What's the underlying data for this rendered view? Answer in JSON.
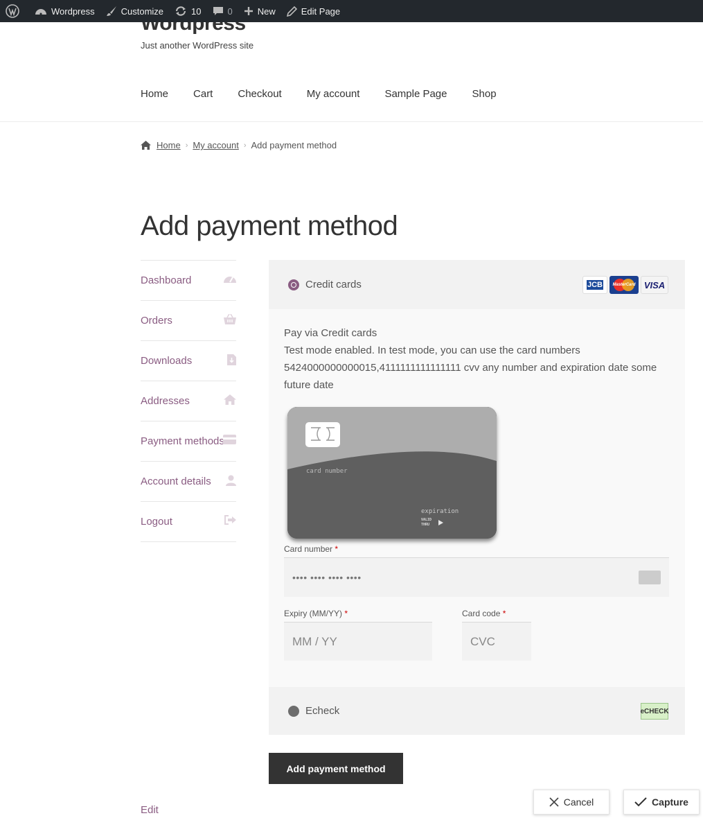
{
  "admin_bar": {
    "site": "Wordpress",
    "customize": "Customize",
    "updates": "10",
    "comments": "0",
    "new": "New",
    "edit": "Edit Page"
  },
  "header": {
    "site_title": "Wordpress",
    "tagline": "Just another WordPress site",
    "nav": [
      "Home",
      "Cart",
      "Checkout",
      "My account",
      "Sample Page",
      "Shop"
    ]
  },
  "breadcrumb": {
    "home": "Home",
    "account": "My account",
    "current": "Add payment method"
  },
  "page_title": "Add payment method",
  "account_nav": [
    {
      "label": "Dashboard",
      "icon": "gauge-icon"
    },
    {
      "label": "Orders",
      "icon": "basket-icon"
    },
    {
      "label": "Downloads",
      "icon": "file-download-icon"
    },
    {
      "label": "Addresses",
      "icon": "home-icon"
    },
    {
      "label": "Payment methods",
      "icon": "credit-card-icon"
    },
    {
      "label": "Account details",
      "icon": "user-icon"
    },
    {
      "label": "Logout",
      "icon": "sign-out-icon"
    }
  ],
  "payment": {
    "credit_cards_label": "Credit cards",
    "logos": [
      "JCB",
      "MasterCard",
      "VISA"
    ],
    "description_title": "Pay via Credit cards",
    "description_body": "Test mode enabled. In test mode, you can use the card numbers 5424000000000015,4111111111111111 cvv any number and expiration date some future date",
    "card_visual": {
      "number_label": "card number",
      "expiration_label": "expiration",
      "valid": "VALID",
      "thru": "THRU"
    },
    "card_number_label": "Card number",
    "card_number_placeholder": "•••• •••• •••• ••••",
    "expiry_label": "Expiry (MM/YY)",
    "expiry_placeholder": "MM / YY",
    "cvc_label": "Card code",
    "cvc_placeholder": "CVC",
    "required_mark": "*",
    "echeck_label": "Echeck",
    "echeck_logo": "eCHECK"
  },
  "submit_label": "Add payment method",
  "edit_label": "Edit",
  "overlay": {
    "cancel": "Cancel",
    "capture": "Capture"
  },
  "colors": {
    "accent": "#8a5c82",
    "admin_bar": "#23282d",
    "button": "#333333"
  }
}
